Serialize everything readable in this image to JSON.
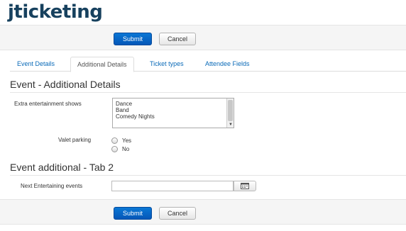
{
  "brand": {
    "name": "jticketing"
  },
  "toolbar": {
    "submit_label": "Submit",
    "cancel_label": "Cancel"
  },
  "tabs": [
    {
      "label": "Event Details",
      "active": false
    },
    {
      "label": "Additional Details",
      "active": true
    },
    {
      "label": "Ticket types",
      "active": false
    },
    {
      "label": "Attendee Fields",
      "active": false
    }
  ],
  "section1": {
    "title": "Event - Additional Details",
    "extra_shows_label": "Extra entertainment shows",
    "extra_shows_options": [
      "Dance",
      "Band",
      "Comedy Nights"
    ],
    "valet_label": "Valet parking",
    "valet_options": [
      "Yes",
      "No"
    ]
  },
  "section2": {
    "title": "Event additional - Tab 2",
    "next_events_label": "Next Entertaining events",
    "next_events_value": ""
  },
  "icons": {
    "calendar": "calendar-icon",
    "scroll_down": "chevron-down-icon"
  },
  "colors": {
    "brand": "#17415e",
    "primary": "#0a77d5",
    "link": "#0a6ab8"
  }
}
